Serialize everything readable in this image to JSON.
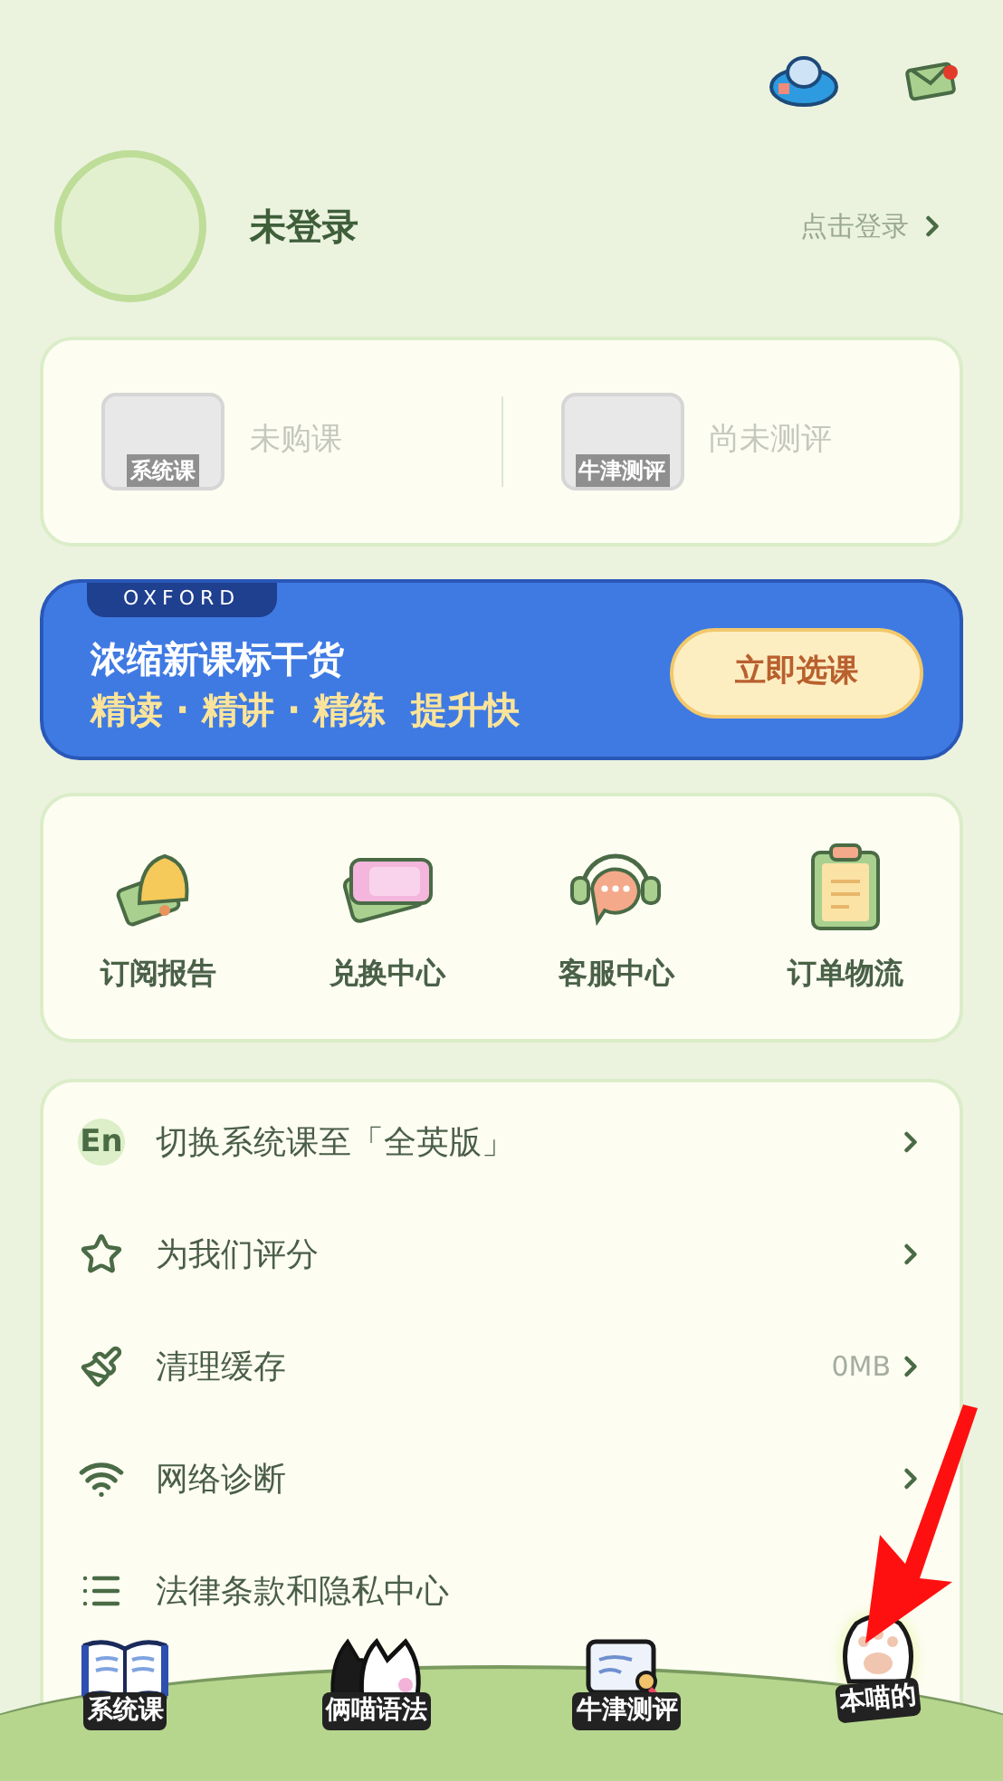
{
  "profile": {
    "name": "未登录",
    "login_link": "点击登录"
  },
  "stats": [
    {
      "badge": "系统课",
      "label": "未购课"
    },
    {
      "badge": "牛津测评",
      "label": "尚未测评"
    }
  ],
  "banner": {
    "tag": "OXFORD",
    "title": "浓缩新课标干货",
    "subtitle": "精读 · 精讲 · 精练  提升快",
    "button": "立即选课"
  },
  "shortcuts": [
    {
      "kind": "bell",
      "label": "订阅报告"
    },
    {
      "kind": "ticket",
      "label": "兑换中心"
    },
    {
      "kind": "headset",
      "label": "客服中心"
    },
    {
      "kind": "clipboard",
      "label": "订单物流"
    }
  ],
  "menu": [
    {
      "kind": "english",
      "badge": "En",
      "label": "切换系统课至「全英版」",
      "chevron": true
    },
    {
      "kind": "star",
      "label": "为我们评分",
      "chevron": true
    },
    {
      "kind": "brush",
      "label": "清理缓存",
      "value": "0MB",
      "chevron": true
    },
    {
      "kind": "wifi",
      "label": "网络诊断",
      "chevron": true
    },
    {
      "kind": "list",
      "label": "法律条款和隐私中心",
      "chevron": false
    }
  ],
  "tabs": [
    {
      "kind": "book",
      "label": "系统课",
      "selected": false
    },
    {
      "kind": "cats",
      "label": "俩喵语法",
      "selected": false
    },
    {
      "kind": "certificate",
      "label": "牛津测评",
      "selected": false
    },
    {
      "kind": "paw",
      "label": "本喵的",
      "selected": true
    }
  ]
}
